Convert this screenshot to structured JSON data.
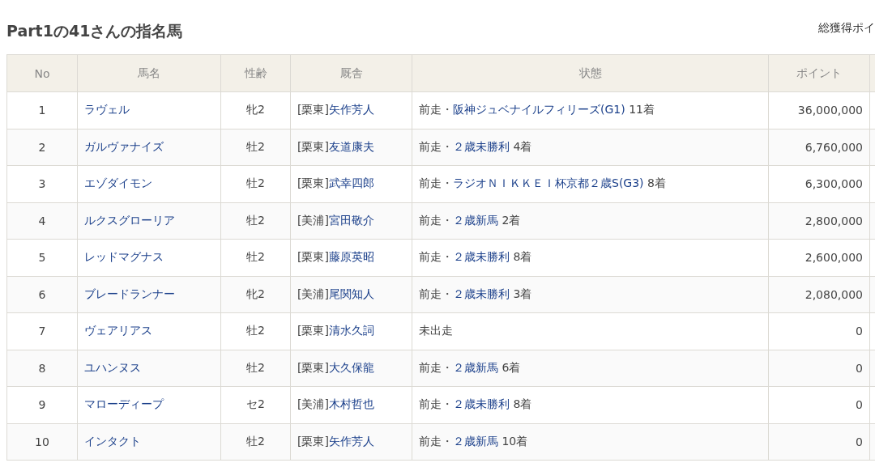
{
  "page": {
    "title": "Part1の41さんの指名馬",
    "total_label": "総獲得ポイ"
  },
  "table": {
    "columns": [
      "No",
      "馬名",
      "性齢",
      "厩舎",
      "状態",
      "ポイント"
    ],
    "rows": [
      {
        "no": "1",
        "horse": "ラヴェル",
        "sex_age": "牝2",
        "stable": {
          "region": "[栗東]",
          "trainer": "矢作芳人"
        },
        "status": {
          "kind": "race",
          "prefix": "前走・",
          "race": "阪神ジュベナイルフィリーズ(G1)",
          "result": "11着"
        },
        "points": "36,000,000"
      },
      {
        "no": "2",
        "horse": "ガルヴァナイズ",
        "sex_age": "牡2",
        "stable": {
          "region": "[栗東]",
          "trainer": "友道康夫"
        },
        "status": {
          "kind": "race",
          "prefix": "前走・",
          "race": "２歳未勝利",
          "result": "4着"
        },
        "points": "6,760,000"
      },
      {
        "no": "3",
        "horse": "エゾダイモン",
        "sex_age": "牡2",
        "stable": {
          "region": "[栗東]",
          "trainer": "武幸四郎"
        },
        "status": {
          "kind": "race",
          "prefix": "前走・",
          "race": "ラジオＮＩＫＫＥＩ杯京都２歳S(G3)",
          "result": "8着"
        },
        "points": "6,300,000"
      },
      {
        "no": "4",
        "horse": "ルクスグローリア",
        "sex_age": "牡2",
        "stable": {
          "region": "[美浦]",
          "trainer": "宮田敬介"
        },
        "status": {
          "kind": "race",
          "prefix": "前走・",
          "race": "２歳新馬",
          "result": "2着"
        },
        "points": "2,800,000"
      },
      {
        "no": "5",
        "horse": "レッドマグナス",
        "sex_age": "牡2",
        "stable": {
          "region": "[栗東]",
          "trainer": "藤原英昭"
        },
        "status": {
          "kind": "race",
          "prefix": "前走・",
          "race": "２歳未勝利",
          "result": "8着"
        },
        "points": "2,600,000"
      },
      {
        "no": "6",
        "horse": "ブレードランナー",
        "sex_age": "牝2",
        "stable": {
          "region": "[美浦]",
          "trainer": "尾関知人"
        },
        "status": {
          "kind": "race",
          "prefix": "前走・",
          "race": "２歳未勝利",
          "result": "3着"
        },
        "points": "2,080,000"
      },
      {
        "no": "7",
        "horse": "ヴェアリアス",
        "sex_age": "牡2",
        "stable": {
          "region": "[栗東]",
          "trainer": "清水久詞"
        },
        "status": {
          "kind": "none",
          "text": "未出走"
        },
        "points": "0"
      },
      {
        "no": "8",
        "horse": "ユハンヌス",
        "sex_age": "牡2",
        "stable": {
          "region": "[栗東]",
          "trainer": "大久保龍"
        },
        "status": {
          "kind": "race",
          "prefix": "前走・",
          "race": "２歳新馬",
          "result": "6着"
        },
        "points": "0"
      },
      {
        "no": "9",
        "horse": "マローディープ",
        "sex_age": "セ2",
        "stable": {
          "region": "[美浦]",
          "trainer": "木村哲也"
        },
        "status": {
          "kind": "race",
          "prefix": "前走・",
          "race": "２歳未勝利",
          "result": "8着"
        },
        "points": "0"
      },
      {
        "no": "10",
        "horse": "インタクト",
        "sex_age": "牡2",
        "stable": {
          "region": "[栗東]",
          "trainer": "矢作芳人"
        },
        "status": {
          "kind": "race",
          "prefix": "前走・",
          "race": "２歳新馬",
          "result": "10着"
        },
        "points": "0"
      }
    ]
  }
}
